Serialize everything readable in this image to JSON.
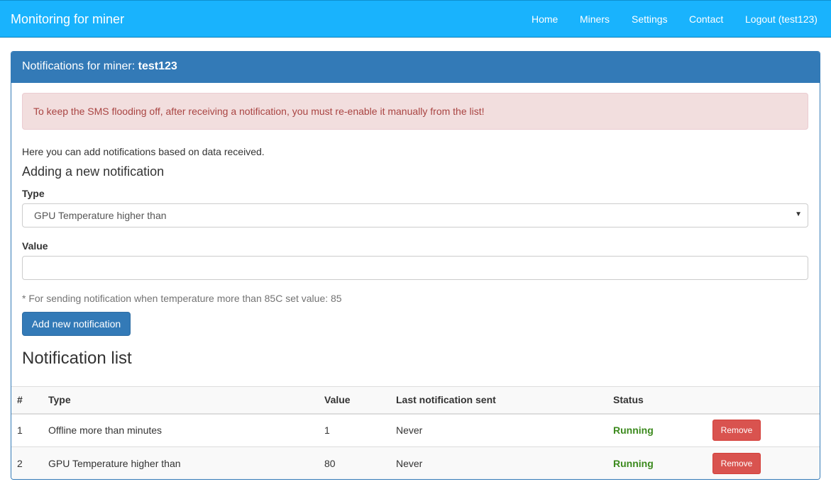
{
  "navbar": {
    "brand": "Monitoring for miner",
    "items": [
      {
        "label": "Home"
      },
      {
        "label": "Miners"
      },
      {
        "label": "Settings"
      },
      {
        "label": "Contact"
      },
      {
        "label": "Logout (test123)"
      }
    ],
    "color": "#19b3fd"
  },
  "panel": {
    "heading_prefix": "Notifications for miner: ",
    "miner_name": "test123"
  },
  "alert": {
    "text": "To keep the SMS flooding off, after receiving a notification, you must re-enable it manually from the list!"
  },
  "form": {
    "intro": "Here you can add notifications based on data received.",
    "title": "Adding a new notification",
    "type_label": "Type",
    "type_selected": "GPU Temperature higher than",
    "value_label": "Value",
    "value": "",
    "hint": "* For sending notification when temperature more than 85C set value: 85",
    "submit_label": "Add new notification"
  },
  "list": {
    "title": "Notification list",
    "columns": [
      "#",
      "Type",
      "Value",
      "Last notification sent",
      "Status",
      ""
    ],
    "rows": [
      {
        "id": "1",
        "type": "Offline more than minutes",
        "value": "1",
        "last_sent": "Never",
        "status": "Running",
        "action": "Remove"
      },
      {
        "id": "2",
        "type": "GPU Temperature higher than",
        "value": "80",
        "last_sent": "Never",
        "status": "Running",
        "action": "Remove"
      }
    ]
  },
  "colors": {
    "primary": "#337ab7",
    "danger": "#d9534f",
    "success": "#3c8a1e"
  }
}
